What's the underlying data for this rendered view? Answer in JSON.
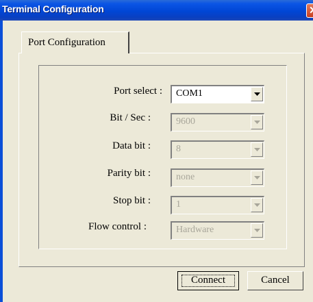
{
  "window": {
    "title": "Terminal Configuration"
  },
  "tabs": [
    {
      "label": "Port Configuration",
      "selected": true
    }
  ],
  "fields": [
    {
      "label": "Port select :",
      "value": "COM1",
      "enabled": true
    },
    {
      "label": "Bit / Sec :",
      "value": "9600",
      "enabled": false
    },
    {
      "label": "Data bit :",
      "value": "8",
      "enabled": false
    },
    {
      "label": "Parity bit :",
      "value": "none",
      "enabled": false
    },
    {
      "label": "Stop bit :",
      "value": "1",
      "enabled": false
    },
    {
      "label": "Flow control :",
      "value": "Hardware",
      "enabled": false
    }
  ],
  "buttons": {
    "connect": "Connect",
    "cancel": "Cancel"
  },
  "icons": {
    "close": "close-icon",
    "dropdown": "chevron-down-icon"
  },
  "colors": {
    "titlebar": "#0046d5",
    "dialog_bg": "#ece9d8",
    "disabled_text": "#a8a69a"
  }
}
